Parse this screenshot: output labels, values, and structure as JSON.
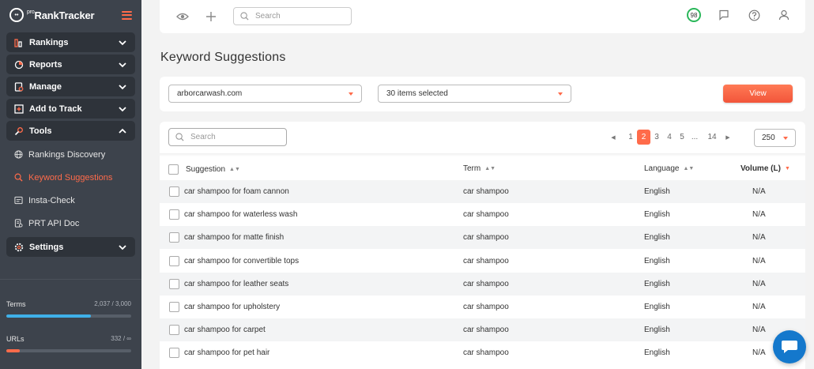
{
  "app": {
    "logo_pre": "pro",
    "logo_text": "RankTracker"
  },
  "sidebar": {
    "groups": [
      {
        "label": "Rankings",
        "icon": "rankings-icon",
        "expanded": false
      },
      {
        "label": "Reports",
        "icon": "reports-icon",
        "expanded": false
      },
      {
        "label": "Manage",
        "icon": "manage-icon",
        "expanded": false
      },
      {
        "label": "Add to Track",
        "icon": "add-to-track-icon",
        "expanded": false
      },
      {
        "label": "Tools",
        "icon": "tools-icon",
        "expanded": true
      }
    ],
    "tools_items": [
      {
        "label": "Rankings Discovery",
        "icon": "globe-icon",
        "active": false
      },
      {
        "label": "Keyword Suggestions",
        "icon": "keyword-search-icon",
        "active": true
      },
      {
        "label": "Insta-Check",
        "icon": "insta-check-icon",
        "active": false
      },
      {
        "label": "PRT API Doc",
        "icon": "api-doc-icon",
        "active": false
      }
    ],
    "settings_label": "Settings",
    "usage": {
      "terms_label": "Terms",
      "terms_value": "2,037 / 3,000",
      "terms_fraction": 0.679,
      "terms_color": "#3fb0e8",
      "urls_label": "URLs",
      "urls_value": "332 / ∞",
      "urls_fraction": 0.11,
      "urls_color": "#ff6b4a"
    }
  },
  "topbar": {
    "search_placeholder": "Search",
    "score": "98",
    "score_color": "#2bb75a"
  },
  "page": {
    "title": "Keyword Suggestions"
  },
  "filters": {
    "domain_value": "arborcarwash.com",
    "items_value": "30 items selected",
    "view_label": "View"
  },
  "table": {
    "search_placeholder": "Search",
    "pagination": {
      "pages": [
        "1",
        "2",
        "3",
        "4",
        "5",
        "...",
        "14"
      ],
      "current": "2"
    },
    "per_page": "250",
    "headers": {
      "suggestion": "Suggestion",
      "term": "Term",
      "language": "Language",
      "volume": "Volume (L)"
    },
    "rows": [
      {
        "suggestion": "car shampoo for foam cannon",
        "term": "car shampoo",
        "language": "English",
        "volume": "N/A"
      },
      {
        "suggestion": "car shampoo for waterless wash",
        "term": "car shampoo",
        "language": "English",
        "volume": "N/A"
      },
      {
        "suggestion": "car shampoo for matte finish",
        "term": "car shampoo",
        "language": "English",
        "volume": "N/A"
      },
      {
        "suggestion": "car shampoo for convertible tops",
        "term": "car shampoo",
        "language": "English",
        "volume": "N/A"
      },
      {
        "suggestion": "car shampoo for leather seats",
        "term": "car shampoo",
        "language": "English",
        "volume": "N/A"
      },
      {
        "suggestion": "car shampoo for upholstery",
        "term": "car shampoo",
        "language": "English",
        "volume": "N/A"
      },
      {
        "suggestion": "car shampoo for carpet",
        "term": "car shampoo",
        "language": "English",
        "volume": "N/A"
      },
      {
        "suggestion": "car shampoo for pet hair",
        "term": "car shampoo",
        "language": "English",
        "volume": "N/A"
      }
    ]
  },
  "colors": {
    "accent": "#ff6b4a",
    "sidebar_bg": "#3d434c",
    "chat_bubble": "#1478cc"
  }
}
